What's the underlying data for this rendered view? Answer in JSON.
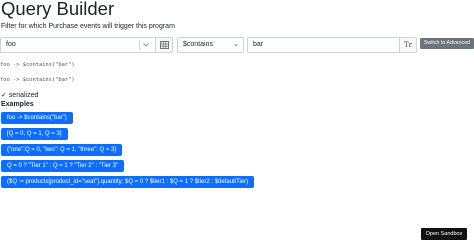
{
  "header": {
    "title": "Query Builder",
    "subtitle": "Filter for which Purchase events will trigger this program"
  },
  "condition": {
    "property_value": "foo",
    "operator_value": "$contains",
    "value_value": "bar",
    "switch_label": "Switch to Advanced"
  },
  "code": {
    "line1": "foo -> $contains(\"bar\")",
    "line2": "foo -> $contains(\"bar\")"
  },
  "serialized_label": "✓ serialized",
  "examples": {
    "label": "Examples",
    "items": [
      "foo -> $contains(\"bar\")",
      "[Q = 0, Q = 1, Q = 3]",
      "{\"one\":Q = 0, \"two\": Q = 1, \"three\": Q = 3}",
      "Q = 0 ? \"Tier 1\" : Q = 1 ? \"Tier 2\" : \"Tier 3\"",
      "($Q := products[product_id=\"seat\"].quantity; $Q = 0 ? $tier1 : $Q = 1 ? $tier2 : $defaultTier)"
    ]
  },
  "footer": {
    "sandbox_label": "Open Sandbox"
  }
}
